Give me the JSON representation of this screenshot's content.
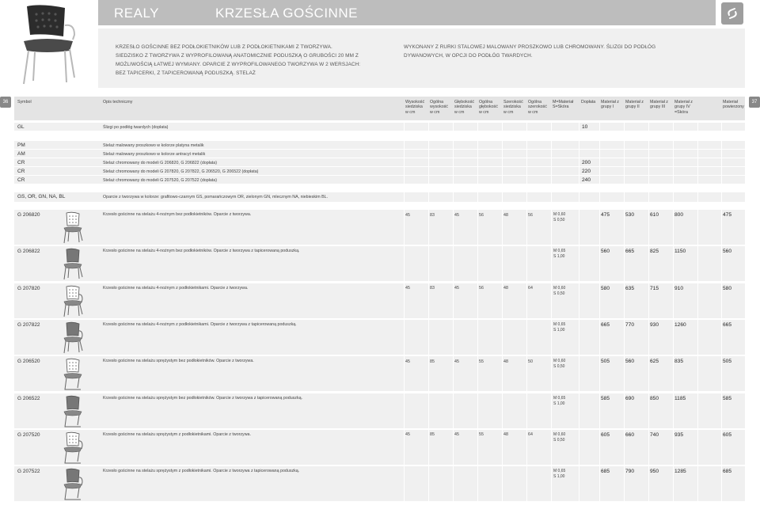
{
  "header": {
    "brand": "REALY",
    "section": "KRZESŁA GOŚCINNE"
  },
  "intro": {
    "col1": "KRZESŁO GOŚCINNE BEZ PODŁOKIETNIKÓW LUB Z PODŁOKIETNIKAMI Z TWORZYWA. SIEDZISKO Z TWORZYWA Z WYPROFILOWANĄ ANATOMICZNIE PODUSZKĄ O GRUBOŚCI 20 MM Z MOŻLIWOŚCIĄ ŁATWEJ WYMIANY. OPARCIE Z WYPROFILOWANEGO TWORZYWA W 2 WERSJACH: BEZ TAPICERKI, Z TAPICEROWANĄ PODUSZKĄ. STELAŻ",
    "col2": "WYKONANY Z RURKI STALOWEJ MALOWANY PROSZKOWO LUB CHROMOWANY. ŚLIZGI DO PODŁÓG DYWANOWYCH, W OPCJI DO PODŁÓG TWARDYCH."
  },
  "pages": {
    "left": "36",
    "right": "37"
  },
  "columns": {
    "symbol": "Symbol",
    "opis": "Opis techniczny",
    "h1": "Wysokość siedziska w cm",
    "h2": "Ogólna wysokość w cm",
    "h3": "Głębokość siedziska w cm",
    "h4": "Ogólna głębokość w cm",
    "h5": "Szerokość siedziska w cm",
    "h6": "Ogólna szerokość w cm",
    "mat": "M=Materiał S=Skóra",
    "doplata": "Dopłata",
    "g1": "Materiał z grupy I",
    "g2": "Materiał z grupy II",
    "g3": "Materiał z grupy III",
    "g4": "Materiał z grupy IV =Skóra",
    "pow": "Materiał powierzony"
  },
  "options": [
    {
      "code": "GL",
      "desc": "Ślizgi po podłóg twardych (dopłata)",
      "doplata": "10"
    },
    {
      "code": "PM",
      "desc": "Stelaż malowany proszkowo w kolorze platyna metalik",
      "doplata": ""
    },
    {
      "code": "AM",
      "desc": "Stelaż malowany proszkowo w kolorze antracyt metalik",
      "doplata": ""
    },
    {
      "code": "CR",
      "desc": "Stelaż chromowany do modeli G 206820, G 206822 (dopłata)",
      "doplata": "200"
    },
    {
      "code": "CR",
      "desc": "Stelaż chromowany do modeli G 207820, G 207822, G 206520, G 206522 (dopłata)",
      "doplata": "220"
    },
    {
      "code": "CR",
      "desc": "Stelaż chromowany do modeli G 207520, G 207522 (dopłata)",
      "doplata": "240"
    },
    {
      "code": "GS, OR, GN, NA, BL",
      "desc": "Oparcie z tworzywa w kolorze: grafitowo-czarnym GS, pomarańczowym OR, zielonym GN, mlecznym NA, niebieskim BL.",
      "doplata": ""
    }
  ],
  "products": [
    {
      "code": "G 206820",
      "desc": "Krzesło gościnne na stelażu 4-nożnym bez podłokietników. Oparcie z tworzywa.",
      "dims": [
        "45",
        "83",
        "45",
        "56",
        "48",
        "56"
      ],
      "mat": [
        "M 0,60",
        "S 0,50"
      ],
      "prices": [
        "475",
        "530",
        "610",
        "800",
        "475"
      ],
      "arms": false,
      "upholstered": false,
      "cantilever": false
    },
    {
      "code": "G 206822",
      "desc": "Krzesło gościnne na stelażu 4-nożnym bez podłokietników. Oparcie z tworzywa z tapicerowaną poduszką.",
      "dims": [
        "",
        "",
        "",
        "",
        "",
        ""
      ],
      "mat": [
        "M 0,65",
        "S 1,00"
      ],
      "prices": [
        "560",
        "665",
        "825",
        "1150",
        "560"
      ],
      "arms": false,
      "upholstered": true,
      "cantilever": false
    },
    {
      "code": "G 207820",
      "desc": "Krzesło gościnne na stelażu 4-nożnym z podłokietnikami. Oparcie z tworzywa.",
      "dims": [
        "45",
        "83",
        "45",
        "56",
        "48",
        "64"
      ],
      "mat": [
        "M 0,60",
        "S 0,50"
      ],
      "prices": [
        "580",
        "635",
        "715",
        "910",
        "580"
      ],
      "arms": true,
      "upholstered": false,
      "cantilever": false
    },
    {
      "code": "G 207822",
      "desc": "Krzesło gościnne na stelażu 4-nożnym z podłokietnikami. Oparcie z tworzywa z tapicerowaną poduszką.",
      "dims": [
        "",
        "",
        "",
        "",
        "",
        ""
      ],
      "mat": [
        "M 0,65",
        "S 1,00"
      ],
      "prices": [
        "665",
        "770",
        "930",
        "1260",
        "665"
      ],
      "arms": true,
      "upholstered": true,
      "cantilever": false
    },
    {
      "code": "G 206520",
      "desc": "Krzesło gościnne na stelażu sprężystym bez podłokietników. Oparcie z tworzywa.",
      "dims": [
        "45",
        "85",
        "45",
        "55",
        "48",
        "50"
      ],
      "mat": [
        "M 0,60",
        "S 0,50"
      ],
      "prices": [
        "505",
        "560",
        "625",
        "835",
        "505"
      ],
      "arms": false,
      "upholstered": false,
      "cantilever": true
    },
    {
      "code": "G 206522",
      "desc": "Krzesło gościnne na stelażu sprężystym bez podłokietników. Oparcie z tworzywa z tapicerowaną poduszką.",
      "dims": [
        "",
        "",
        "",
        "",
        "",
        ""
      ],
      "mat": [
        "M 0,65",
        "S 1,00"
      ],
      "prices": [
        "585",
        "690",
        "850",
        "1185",
        "585"
      ],
      "arms": false,
      "upholstered": true,
      "cantilever": true
    },
    {
      "code": "G 207520",
      "desc": "Krzesło gościnne na stelażu sprężystym z podłokietnikami. Oparcie z tworzywa.",
      "dims": [
        "45",
        "85",
        "45",
        "55",
        "48",
        "64"
      ],
      "mat": [
        "M 0,60",
        "S 0,50"
      ],
      "prices": [
        "605",
        "660",
        "740",
        "935",
        "605"
      ],
      "arms": true,
      "upholstered": false,
      "cantilever": true
    },
    {
      "code": "G 207522",
      "desc": "Krzesło gościnne na stelażu sprężystym z podłokietnikami. Oparcie z tworzywa z tapicerowaną poduszką.",
      "dims": [
        "",
        "",
        "",
        "",
        "",
        ""
      ],
      "mat": [
        "M 0,65",
        "S 1,00"
      ],
      "prices": [
        "685",
        "790",
        "950",
        "1285",
        "685"
      ],
      "arms": true,
      "upholstered": true,
      "cantilever": true
    }
  ]
}
